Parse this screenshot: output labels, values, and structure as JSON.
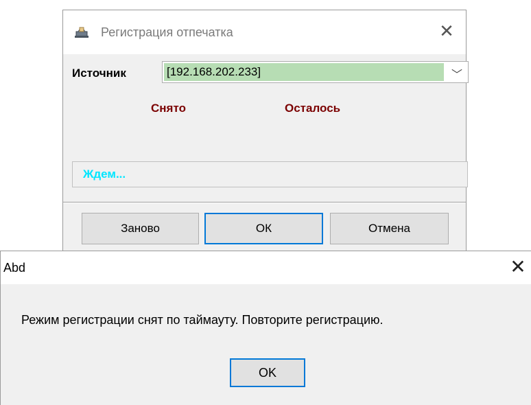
{
  "registration_window": {
    "title": "Регистрация отпечатка",
    "title_icon": "fingerprint-scanner-icon",
    "close_icon": "close-icon",
    "source_label": "Источник",
    "source_value": "[192.168.202.233]",
    "dropdown_icon": "chevron-down-icon",
    "taken_label": "Снято",
    "remaining_label": "Осталось",
    "status_text": "Ждем...",
    "buttons": {
      "again": "Заново",
      "ok": "ОК",
      "cancel": "Отмена"
    },
    "colors": {
      "source_highlight": "#b7ddb4",
      "counter_labels": "#7b0000",
      "status_text": "#00e6ff",
      "default_button_border": "#0078d7"
    }
  },
  "message_box": {
    "title": "Abd",
    "close_icon": "close-icon",
    "message": "Режим регистрации снят по таймауту. Повторите регистрацию.",
    "ok_label": "OK"
  }
}
